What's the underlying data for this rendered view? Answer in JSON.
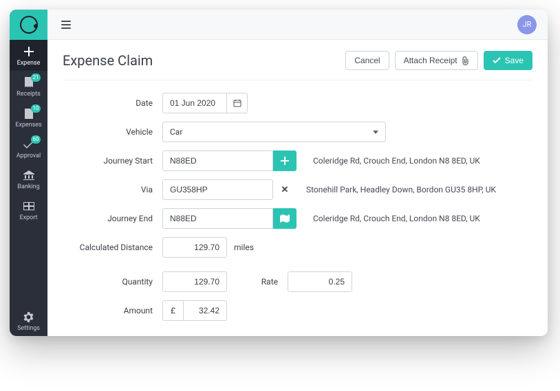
{
  "user": {
    "initials": "JR"
  },
  "sidebar": {
    "items": [
      {
        "label": "Expense",
        "badge": null
      },
      {
        "label": "Receipts",
        "badge": "21"
      },
      {
        "label": "Expenses",
        "badge": "10"
      },
      {
        "label": "Approval",
        "badge": "60"
      },
      {
        "label": "Banking",
        "badge": null
      },
      {
        "label": "Export",
        "badge": null
      }
    ],
    "settings_label": "Settings"
  },
  "header": {
    "title": "Expense Claim",
    "cancel": "Cancel",
    "attach": "Attach Receipt",
    "save": "Save"
  },
  "form": {
    "labels": {
      "date": "Date",
      "vehicle": "Vehicle",
      "start": "Journey Start",
      "via": "Via",
      "end": "Journey End",
      "distance": "Calculated Distance",
      "quantity": "Quantity",
      "rate": "Rate",
      "amount": "Amount"
    },
    "date": "01 Jun 2020",
    "vehicle": "Car",
    "start_code": "N88ED",
    "start_addr": "Coleridge Rd, Crouch End, London N8 8ED, UK",
    "via_code": "GU358HP",
    "via_addr": "Stonehill Park, Headley Down, Bordon GU35 8HP, UK",
    "end_code": "N88ED",
    "end_addr": "Coleridge Rd, Crouch End, London N8 8ED, UK",
    "distance": "129.70",
    "distance_unit": "miles",
    "quantity": "129.70",
    "rate": "0.25",
    "currency": "£",
    "amount": "32.42"
  }
}
